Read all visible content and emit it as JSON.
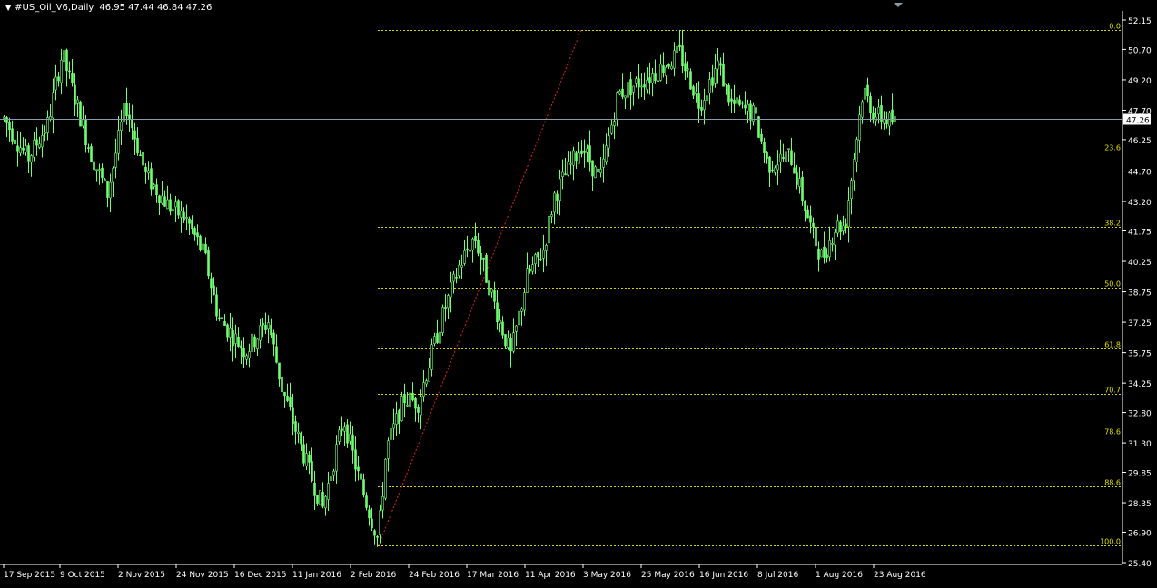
{
  "header": {
    "symbol_timeframe": "#US_Oil_V6,Daily",
    "ohlc": "46.95 47.44 46.84 47.26"
  },
  "price_axis": {
    "labels": [
      "52.15",
      "50.70",
      "49.20",
      "47.70",
      "46.25",
      "44.70",
      "43.20",
      "41.75",
      "40.25",
      "38.75",
      "37.25",
      "35.75",
      "34.25",
      "32.80",
      "31.30",
      "29.85",
      "28.35",
      "26.90",
      "25.40"
    ],
    "min": 25.4,
    "max": 52.15,
    "current_price": "47.26"
  },
  "time_axis": {
    "labels": [
      "17 Sep 2015",
      "9 Oct 2015",
      "2 Nov 2015",
      "24 Nov 2015",
      "16 Dec 2015",
      "11 Jan 2016",
      "2 Feb 2016",
      "24 Feb 2016",
      "17 Mar 2016",
      "11 Apr 2016",
      "3 May 2016",
      "25 May 2016",
      "16 Jun 2016",
      "8 Jul 2016",
      "1 Aug 2016",
      "23 Aug 2016"
    ]
  },
  "fibonacci": {
    "levels": [
      {
        "label": "0.0",
        "price": 51.67
      },
      {
        "label": "23.6",
        "price": 45.68
      },
      {
        "label": "38.2",
        "price": 41.97
      },
      {
        "label": "50.0",
        "price": 38.97
      },
      {
        "label": "61.8",
        "price": 35.96
      },
      {
        "label": "70.7",
        "price": 33.7
      },
      {
        "label": "78.6",
        "price": 31.68
      },
      {
        "label": "88.6",
        "price": 29.15
      },
      {
        "label": "100.0",
        "price": 26.25
      }
    ],
    "high_price": 51.67,
    "low_price": 26.25
  },
  "colors": {
    "background": "#000000",
    "candle": "#6fff6f",
    "fib_line": "#d4d400",
    "fib_label": "#e0e000",
    "trend_line": "#e02020",
    "axis_text": "#ffffff",
    "current_line": "#8a9aa8"
  }
}
